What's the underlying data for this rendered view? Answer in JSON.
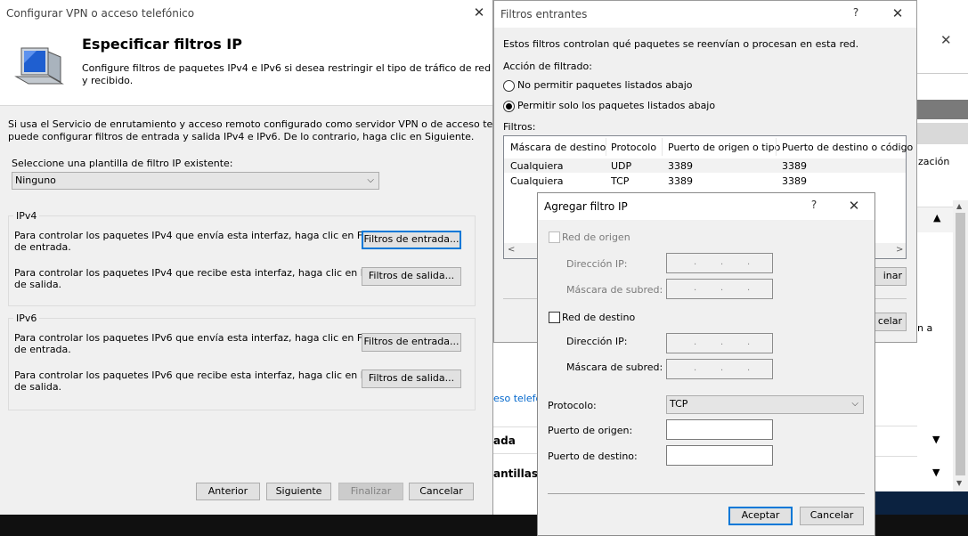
{
  "wizard": {
    "title": "Configurar VPN o acceso telefónico",
    "heading": "Especificar filtros IP",
    "header_desc_1": "Configure filtros de paquetes IPv4 e IPv6 si desea restringir el tipo de tráfico de red enviado",
    "header_desc_2": "y recibido.",
    "intro_1": "Si usa el Servicio de enrutamiento y acceso remoto configurado como servidor VPN o de acceso telefónico,",
    "intro_2": "puede configurar filtros de entrada y salida IPv4 e IPv6. De lo contrario, haga clic en Siguiente.",
    "template_label": "Seleccione una plantilla de filtro IP existente:",
    "template_value": "Ninguno",
    "ipv4": {
      "label": "IPv4",
      "in_text_1": "Para controlar los paquetes IPv4 que envía esta interfaz, haga clic en Filtros",
      "in_text_2": "de entrada.",
      "in_button": "Filtros de entrada...",
      "out_text_1": "Para controlar los paquetes IPv4 que recibe esta interfaz, haga clic en Filtros",
      "out_text_2": "de salida.",
      "out_button": "Filtros de salida..."
    },
    "ipv6": {
      "label": "IPv6",
      "in_text_1": "Para controlar los paquetes IPv6 que envía esta interfaz, haga clic en Filtros",
      "in_text_2": "de entrada.",
      "in_button": "Filtros de entrada...",
      "out_text_1": "Para controlar los paquetes IPv6 que recibe esta interfaz, haga clic en Filtros",
      "out_text_2": "de salida.",
      "out_button": "Filtros de salida..."
    },
    "buttons": {
      "back": "Anterior",
      "next": "Siguiente",
      "finish": "Finalizar",
      "cancel": "Cancelar"
    }
  },
  "incoming": {
    "title": "Filtros entrantes",
    "help": "?",
    "desc": "Estos filtros controlan qué paquetes se reenvían o procesan en esta red.",
    "action_label": "Acción de filtrado:",
    "option_deny": "No permitir paquetes listados abajo",
    "option_allow": "Permitir solo los paquetes listados abajo",
    "filters_label": "Filtros:",
    "columns": [
      "Máscara de destino",
      "Protocolo",
      "Puerto de origen o tipo",
      "Puerto de destino o código"
    ],
    "rows": [
      [
        "Cualquiera",
        "UDP",
        "3389",
        "3389"
      ],
      [
        "Cualquiera",
        "TCP",
        "3389",
        "3389"
      ]
    ],
    "btn_partial_1": "inar",
    "btn_partial_2": "celar"
  },
  "background": {
    "link_partial": "eso telefó",
    "text_partial_1": "zación",
    "text_partial_2": "n a",
    "section_1": "ada",
    "section_2": "antillas"
  },
  "add_filter": {
    "title": "Agregar filtro IP",
    "help": "?",
    "source_network": "Red de origen",
    "source_ip": "Dirección IP:",
    "source_mask": "Máscara de subred:",
    "dest_network": "Red de destino",
    "dest_ip": "Dirección IP:",
    "dest_mask": "Máscara de subred:",
    "protocol_label": "Protocolo:",
    "protocol_value": "TCP",
    "source_port_label": "Puerto de origen:",
    "dest_port_label": "Puerto de destino:",
    "ok": "Aceptar",
    "cancel": "Cancelar"
  }
}
